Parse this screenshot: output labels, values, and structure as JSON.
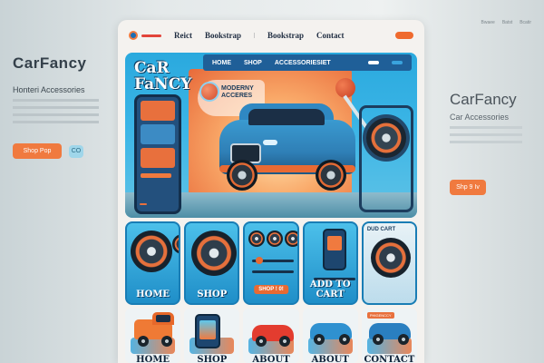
{
  "left_panel": {
    "brand": "CarFancy",
    "subtitle": "Honteri Accessories",
    "primary_button": "Shop Pop",
    "secondary_button": "CO"
  },
  "right_panel": {
    "brand": "CarFancy",
    "subtitle": "Car Accessories",
    "button": "Shp 9 Iv",
    "top_links": [
      "Bwaee",
      "Batst",
      "Bcatir"
    ]
  },
  "topnav": {
    "links": [
      "Reict",
      "Bookstrap",
      "Bookstrap",
      "Contact"
    ],
    "cta": ""
  },
  "hero": {
    "title_line1": "CaR",
    "title_line2": "FaNCY",
    "nav": [
      "HOME",
      "SHOP",
      "ACCESSORIESIET"
    ],
    "badge_text": "MODERNY ACCERES",
    "side_tag": ""
  },
  "mid_cards": [
    {
      "label": "HOME"
    },
    {
      "label": "SHOP"
    },
    {
      "label": "SHOP ! 0!"
    },
    {
      "label": "ADD TO CART"
    },
    {
      "label": ""
    }
  ],
  "mid_card5_header": "DUD CART",
  "bottom_cards": [
    {
      "label": "HOME",
      "chip": ""
    },
    {
      "label": "SHOP",
      "chip": ""
    },
    {
      "label": "ABOUT",
      "chip": ""
    },
    {
      "label": "ABOUT",
      "chip": ""
    },
    {
      "label": "CONTACT",
      "chip": "PHIGENCCY"
    }
  ],
  "colors": {
    "accent_orange": "#ef6a2e",
    "brand_blue": "#1f5f98",
    "sky_blue": "#3bb5e6"
  }
}
